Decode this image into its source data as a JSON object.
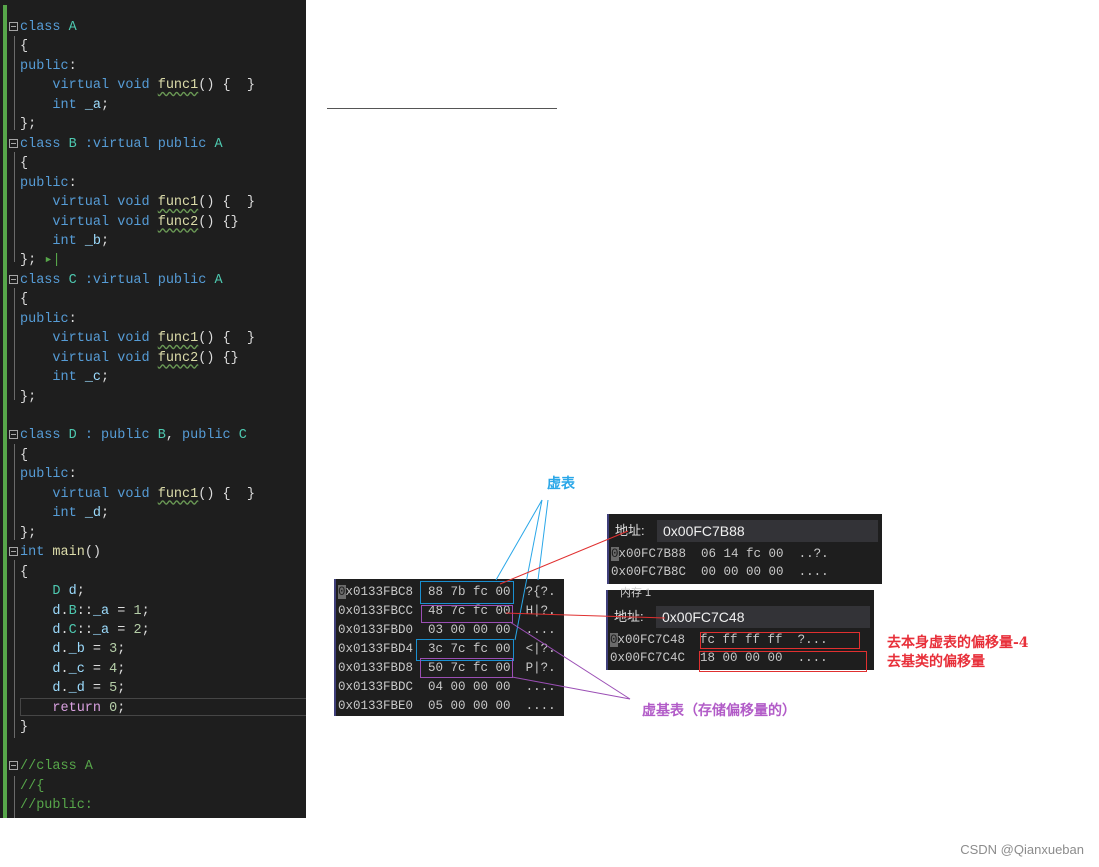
{
  "editor": {
    "lines": [
      {
        "fold": true,
        "tokens": [
          [
            "kw",
            "class "
          ],
          [
            "ty",
            "A"
          ]
        ]
      },
      {
        "fold": false,
        "tokens": [
          [
            "",
            "{"
          ]
        ]
      },
      {
        "fold": false,
        "tokens": [
          [
            "kw",
            "public"
          ],
          [
            "",
            ":"
          ]
        ]
      },
      {
        "fold": false,
        "tokens": [
          [
            "",
            "    "
          ],
          [
            "kw",
            "virtual void "
          ],
          [
            "fn",
            "func1"
          ],
          [
            "",
            "() {  }"
          ]
        ]
      },
      {
        "fold": false,
        "tokens": [
          [
            "",
            "    "
          ],
          [
            "kw",
            "int "
          ],
          [
            "var",
            "_a"
          ],
          [
            "",
            ";"
          ]
        ]
      },
      {
        "fold": false,
        "tokens": [
          [
            "",
            "};"
          ]
        ]
      },
      {
        "fold": true,
        "tokens": [
          [
            "kw",
            "class "
          ],
          [
            "ty",
            "B"
          ],
          [
            "kw",
            " :virtual public "
          ],
          [
            "ty",
            "A"
          ]
        ]
      },
      {
        "fold": false,
        "tokens": [
          [
            "",
            "{"
          ]
        ]
      },
      {
        "fold": false,
        "tokens": [
          [
            "kw",
            "public"
          ],
          [
            "",
            ":"
          ]
        ]
      },
      {
        "fold": false,
        "tokens": [
          [
            "",
            "    "
          ],
          [
            "kw",
            "virtual void "
          ],
          [
            "fn",
            "func1"
          ],
          [
            "",
            "() {  }"
          ]
        ]
      },
      {
        "fold": false,
        "tokens": [
          [
            "",
            "    "
          ],
          [
            "kw",
            "virtual void "
          ],
          [
            "fn",
            "func2"
          ],
          [
            "",
            "() {}"
          ]
        ]
      },
      {
        "fold": false,
        "tokens": [
          [
            "",
            "    "
          ],
          [
            "kw",
            "int "
          ],
          [
            "var",
            "_b"
          ],
          [
            "",
            ";"
          ]
        ]
      },
      {
        "fold": false,
        "tokens": [
          [
            "",
            "}; "
          ],
          [
            "cm",
            "▸|"
          ]
        ]
      },
      {
        "fold": true,
        "tokens": [
          [
            "kw",
            "class "
          ],
          [
            "ty",
            "C"
          ],
          [
            "kw",
            " :virtual public "
          ],
          [
            "ty",
            "A"
          ]
        ]
      },
      {
        "fold": false,
        "tokens": [
          [
            "",
            "{"
          ]
        ]
      },
      {
        "fold": false,
        "tokens": [
          [
            "kw",
            "public"
          ],
          [
            "",
            ":"
          ]
        ]
      },
      {
        "fold": false,
        "tokens": [
          [
            "",
            "    "
          ],
          [
            "kw",
            "virtual void "
          ],
          [
            "fn",
            "func1"
          ],
          [
            "",
            "() {  }"
          ]
        ]
      },
      {
        "fold": false,
        "tokens": [
          [
            "",
            "    "
          ],
          [
            "kw",
            "virtual void "
          ],
          [
            "fn",
            "func2"
          ],
          [
            "",
            "() {}"
          ]
        ]
      },
      {
        "fold": false,
        "tokens": [
          [
            "",
            "    "
          ],
          [
            "kw",
            "int "
          ],
          [
            "var",
            "_c"
          ],
          [
            "",
            ";"
          ]
        ]
      },
      {
        "fold": false,
        "tokens": [
          [
            "",
            "};"
          ]
        ]
      },
      {
        "fold": false,
        "tokens": [
          [
            "",
            ""
          ]
        ]
      },
      {
        "fold": true,
        "tokens": [
          [
            "kw",
            "class "
          ],
          [
            "ty",
            "D"
          ],
          [
            "kw",
            " : public "
          ],
          [
            "ty",
            "B"
          ],
          [
            "",
            ", "
          ],
          [
            "kw",
            "public "
          ],
          [
            "ty",
            "C"
          ]
        ]
      },
      {
        "fold": false,
        "tokens": [
          [
            "",
            "{"
          ]
        ]
      },
      {
        "fold": false,
        "tokens": [
          [
            "kw",
            "public"
          ],
          [
            "",
            ":"
          ]
        ]
      },
      {
        "fold": false,
        "tokens": [
          [
            "",
            "    "
          ],
          [
            "kw",
            "virtual void "
          ],
          [
            "fn",
            "func1"
          ],
          [
            "",
            "() {  }"
          ]
        ]
      },
      {
        "fold": false,
        "tokens": [
          [
            "",
            "    "
          ],
          [
            "kw",
            "int "
          ],
          [
            "var",
            "_d"
          ],
          [
            "",
            ";"
          ]
        ]
      },
      {
        "fold": false,
        "tokens": [
          [
            "",
            "};"
          ]
        ]
      },
      {
        "fold": true,
        "tokens": [
          [
            "kw",
            "int "
          ],
          [
            "fnp",
            "main"
          ],
          [
            "",
            "()"
          ]
        ]
      },
      {
        "fold": false,
        "tokens": [
          [
            "",
            "{"
          ]
        ]
      },
      {
        "fold": false,
        "tokens": [
          [
            "",
            "    "
          ],
          [
            "ty",
            "D"
          ],
          [
            "var",
            " d"
          ],
          [
            "",
            ";"
          ]
        ]
      },
      {
        "fold": false,
        "tokens": [
          [
            "",
            "    "
          ],
          [
            "var",
            "d"
          ],
          [
            "",
            "."
          ],
          [
            "ty",
            "B"
          ],
          [
            "",
            "::"
          ],
          [
            "var",
            "_a"
          ],
          [
            "",
            " = "
          ],
          [
            "num",
            "1"
          ],
          [
            "",
            ";"
          ]
        ]
      },
      {
        "fold": false,
        "tokens": [
          [
            "",
            "    "
          ],
          [
            "var",
            "d"
          ],
          [
            "",
            "."
          ],
          [
            "ty",
            "C"
          ],
          [
            "",
            "::"
          ],
          [
            "var",
            "_a"
          ],
          [
            "",
            " = "
          ],
          [
            "num",
            "2"
          ],
          [
            "",
            ";"
          ]
        ]
      },
      {
        "fold": false,
        "tokens": [
          [
            "",
            "    "
          ],
          [
            "var",
            "d"
          ],
          [
            "",
            "."
          ],
          [
            "var",
            "_b"
          ],
          [
            "",
            " = "
          ],
          [
            "num",
            "3"
          ],
          [
            "",
            ";"
          ]
        ]
      },
      {
        "fold": false,
        "tokens": [
          [
            "",
            "    "
          ],
          [
            "var",
            "d"
          ],
          [
            "",
            "."
          ],
          [
            "var",
            "_c"
          ],
          [
            "",
            " = "
          ],
          [
            "num",
            "4"
          ],
          [
            "",
            ";"
          ]
        ]
      },
      {
        "fold": false,
        "tokens": [
          [
            "",
            "    "
          ],
          [
            "var",
            "d"
          ],
          [
            "",
            "."
          ],
          [
            "var",
            "_d"
          ],
          [
            "",
            " = "
          ],
          [
            "num",
            "5"
          ],
          [
            "",
            ";"
          ]
        ]
      },
      {
        "fold": false,
        "tokens": [
          [
            "",
            "    "
          ],
          [
            "ret",
            "return "
          ],
          [
            "num",
            "0"
          ],
          [
            "",
            ";"
          ]
        ]
      },
      {
        "fold": false,
        "tokens": [
          [
            "",
            "}"
          ]
        ]
      },
      {
        "fold": false,
        "tokens": [
          [
            "",
            ""
          ]
        ]
      },
      {
        "fold": true,
        "tokens": [
          [
            "cm",
            "//class A"
          ]
        ]
      },
      {
        "fold": false,
        "tokens": [
          [
            "cm",
            "//{"
          ]
        ]
      },
      {
        "fold": false,
        "tokens": [
          [
            "cm",
            "//public:"
          ]
        ]
      }
    ]
  },
  "memory_main": {
    "rows": [
      {
        "addr_first": "0",
        "addr_rest": "x0133FBC8",
        "bytes": "88 7b fc 00",
        "ascii": "?{?."
      },
      {
        "addr_first": "",
        "addr_rest": "0x0133FBCC",
        "bytes": "48 7c fc 00",
        "ascii": "H|?."
      },
      {
        "addr_first": "",
        "addr_rest": "0x0133FBD0",
        "bytes": "03 00 00 00",
        "ascii": "...."
      },
      {
        "addr_first": "",
        "addr_rest": "0x0133FBD4",
        "bytes": "3c 7c fc 00",
        "ascii": "<|?."
      },
      {
        "addr_first": "",
        "addr_rest": "0x0133FBD8",
        "bytes": "50 7c fc 00",
        "ascii": "P|?."
      },
      {
        "addr_first": "",
        "addr_rest": "0x0133FBDC",
        "bytes": "04 00 00 00",
        "ascii": "...."
      },
      {
        "addr_first": "",
        "addr_rest": "0x0133FBE0",
        "bytes": "05 00 00 00",
        "ascii": "...."
      }
    ]
  },
  "memory_vtable": {
    "address_label": "地址:",
    "address_value": "0x00FC7B88",
    "rows": [
      {
        "addr_first": "0",
        "addr_rest": "x00FC7B88",
        "bytes": "06 14 fc 00",
        "ascii": "..?."
      },
      {
        "addr_first": "",
        "addr_rest": "0x00FC7B8C",
        "bytes": "00 00 00 00",
        "ascii": "...."
      }
    ]
  },
  "memory_vbtable": {
    "tab_label": "内存 1",
    "address_label": "地址:",
    "address_value": "0x00FC7C48",
    "rows": [
      {
        "addr_first": "0",
        "addr_rest": "x00FC7C48",
        "bytes": "fc ff ff ff",
        "ascii": "?..."
      },
      {
        "addr_first": "",
        "addr_rest": "0x00FC7C4C",
        "bytes": "18 00 00 00",
        "ascii": "...."
      }
    ]
  },
  "annotations": {
    "vtable": "虚表",
    "vbtable": "虚基表（存储偏移量的）",
    "offset_self": "去本身虚表的偏移量-4",
    "offset_base": "去基类的偏移量"
  },
  "colors": {
    "blue": "#1a8fd0",
    "purple": "#9b4fb5",
    "red": "#e03030"
  },
  "watermark": "CSDN @Qianxueban"
}
